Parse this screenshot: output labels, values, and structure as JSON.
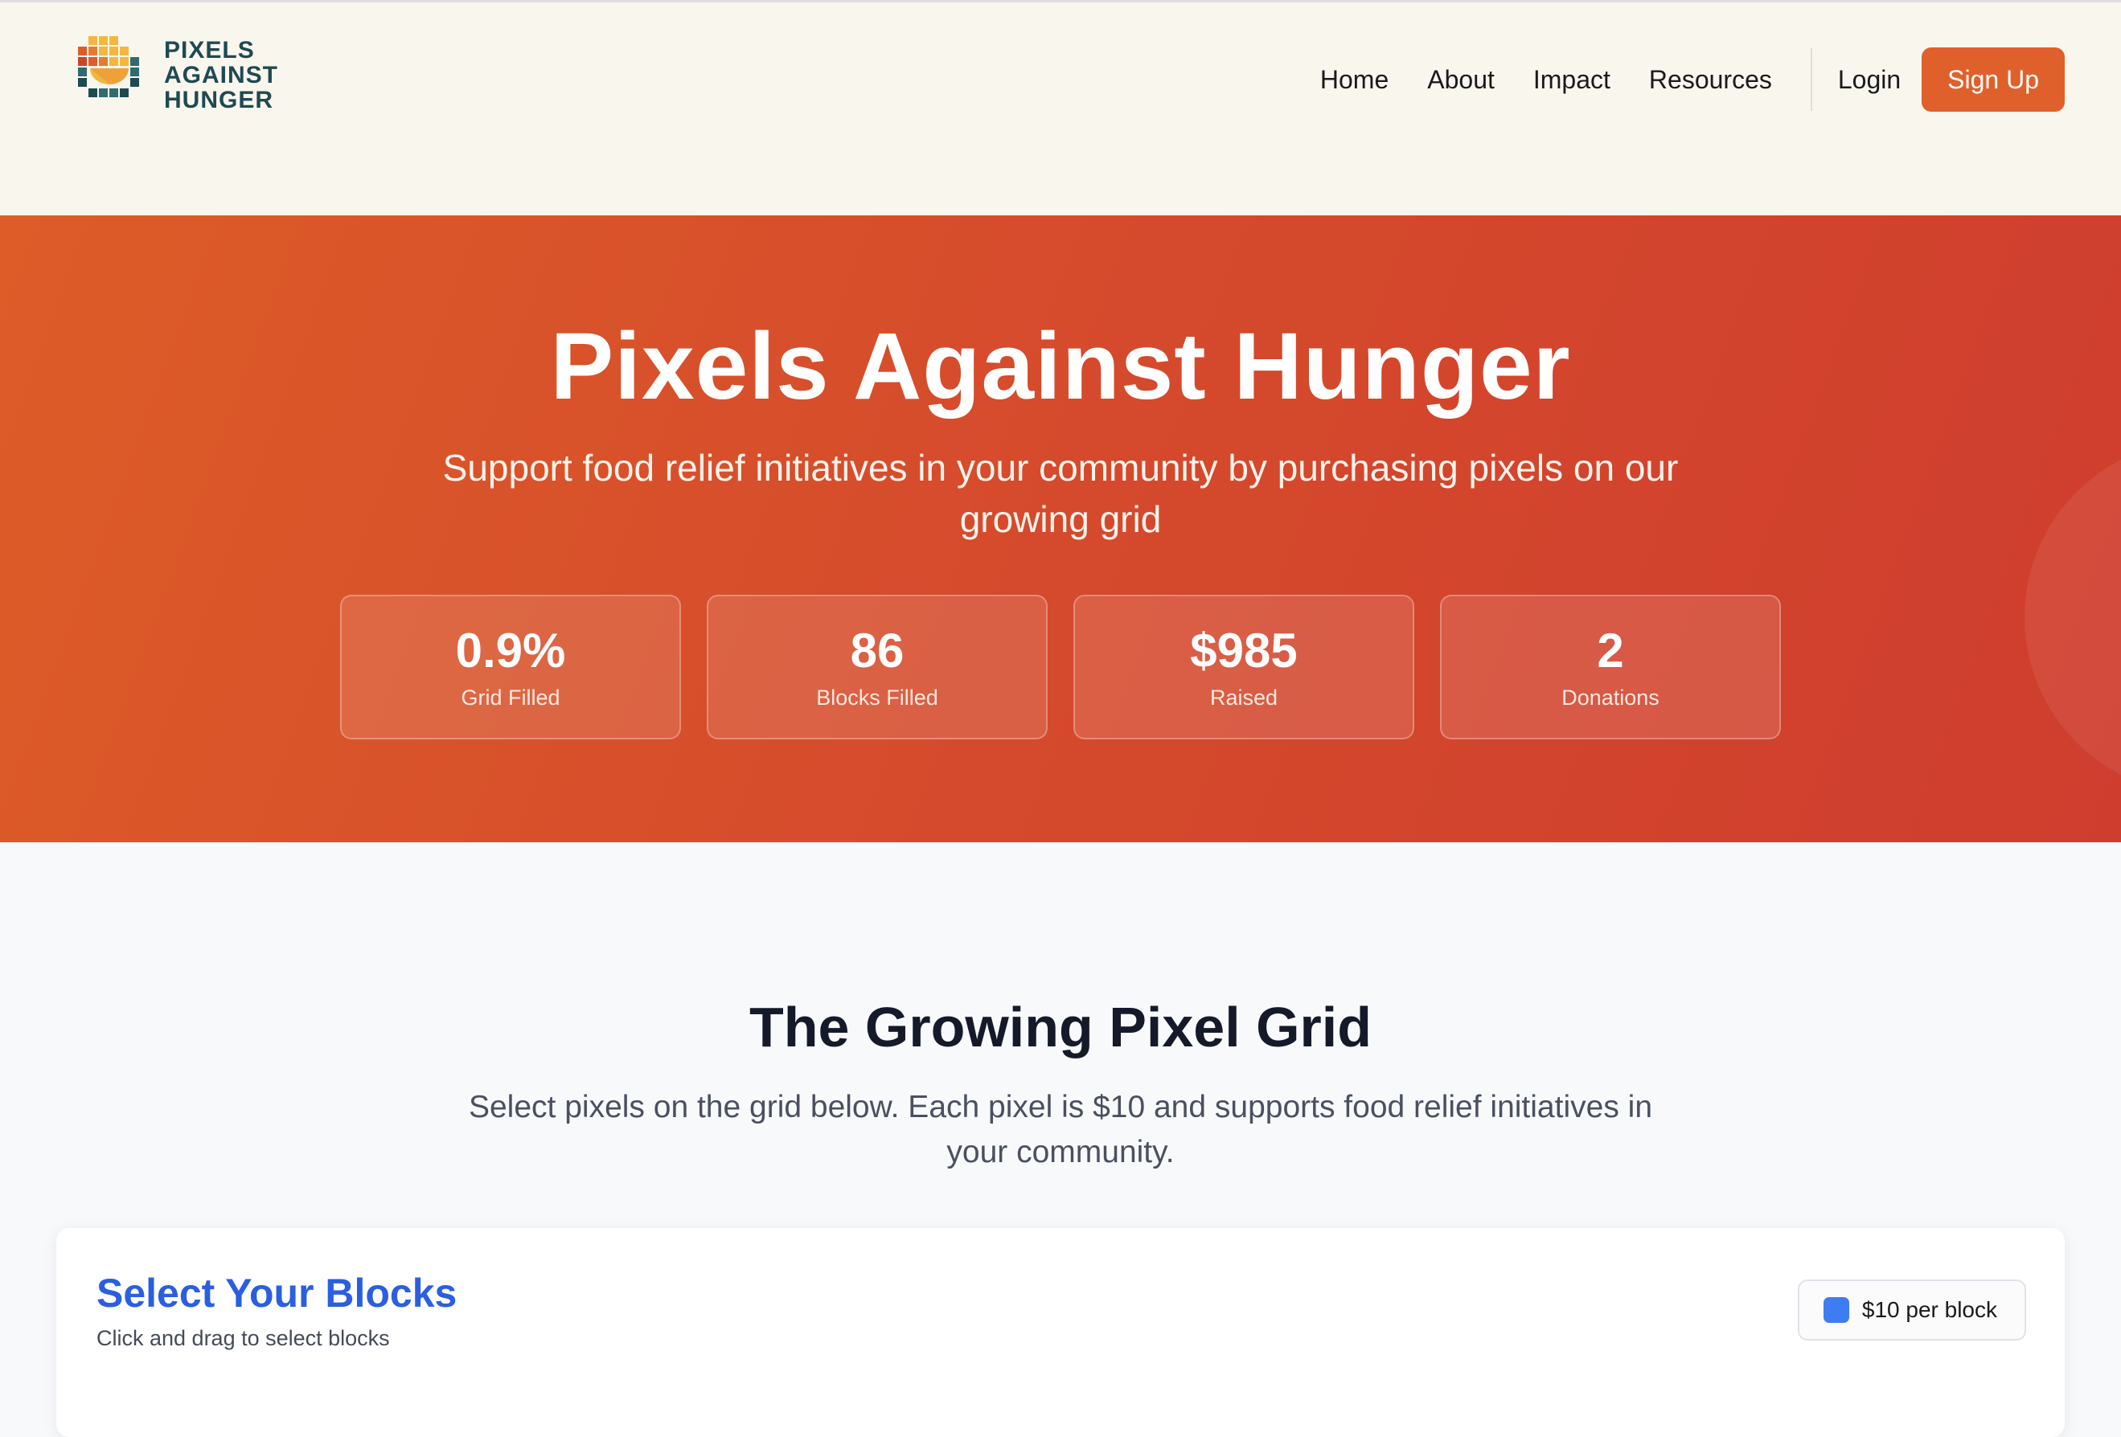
{
  "brand": {
    "logo_line1": "PIXELS",
    "logo_line2": "AGAINST",
    "logo_line3": "HUNGER"
  },
  "nav": {
    "items": [
      "Home",
      "About",
      "Impact",
      "Resources"
    ],
    "login": "Login",
    "signup": "Sign Up"
  },
  "hero": {
    "title": "Pixels Against Hunger",
    "subtitle": "Support food relief initiatives in your community by purchasing pixels on our growing grid",
    "stats": [
      {
        "value": "0.9%",
        "label": "Grid Filled"
      },
      {
        "value": "86",
        "label": "Blocks Filled"
      },
      {
        "value": "$985",
        "label": "Raised"
      },
      {
        "value": "2",
        "label": "Donations"
      }
    ]
  },
  "grid_section": {
    "title": "The Growing Pixel Grid",
    "subtitle": "Select pixels on the grid below. Each pixel is $10 and supports food relief initiatives in your community.",
    "card_title": "Select Your Blocks",
    "card_subtitle": "Click and drag to select blocks",
    "price_label": "$10 per block"
  },
  "colors": {
    "accent": "#e0602b",
    "hero_start": "#dd5c28",
    "hero_end": "#cf3d2e",
    "link_blue": "#2b5fe0",
    "swatch_blue": "#3d7cf2",
    "logo_teal": "#1e4a52"
  },
  "icons": {
    "logo": "pixel-bowl-logo-icon",
    "price_swatch": "blue-square-icon"
  }
}
